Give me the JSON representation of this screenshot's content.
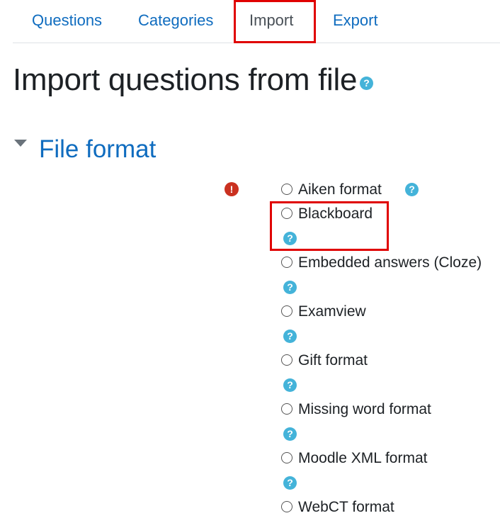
{
  "tabs": {
    "questions": "Questions",
    "categories": "Categories",
    "import": "Import",
    "export": "Export"
  },
  "page": {
    "title": "Import questions from file",
    "help_glyph": "?"
  },
  "section": {
    "title": "File format",
    "required_glyph": "!"
  },
  "formats": [
    {
      "label": "Aiken format",
      "help": "?"
    },
    {
      "label": "Blackboard",
      "help": "?"
    },
    {
      "label": "Embedded answers (Cloze)",
      "help": "?"
    },
    {
      "label": "Examview",
      "help": "?"
    },
    {
      "label": "Gift format",
      "help": "?"
    },
    {
      "label": "Missing word format",
      "help": "?"
    },
    {
      "label": "Moodle XML format",
      "help": "?"
    },
    {
      "label": "WebCT format"
    }
  ],
  "colors": {
    "link": "#0f6cbf",
    "help_icon": "#44b3d9",
    "required_icon": "#ca3120",
    "highlight": "#e00000"
  }
}
